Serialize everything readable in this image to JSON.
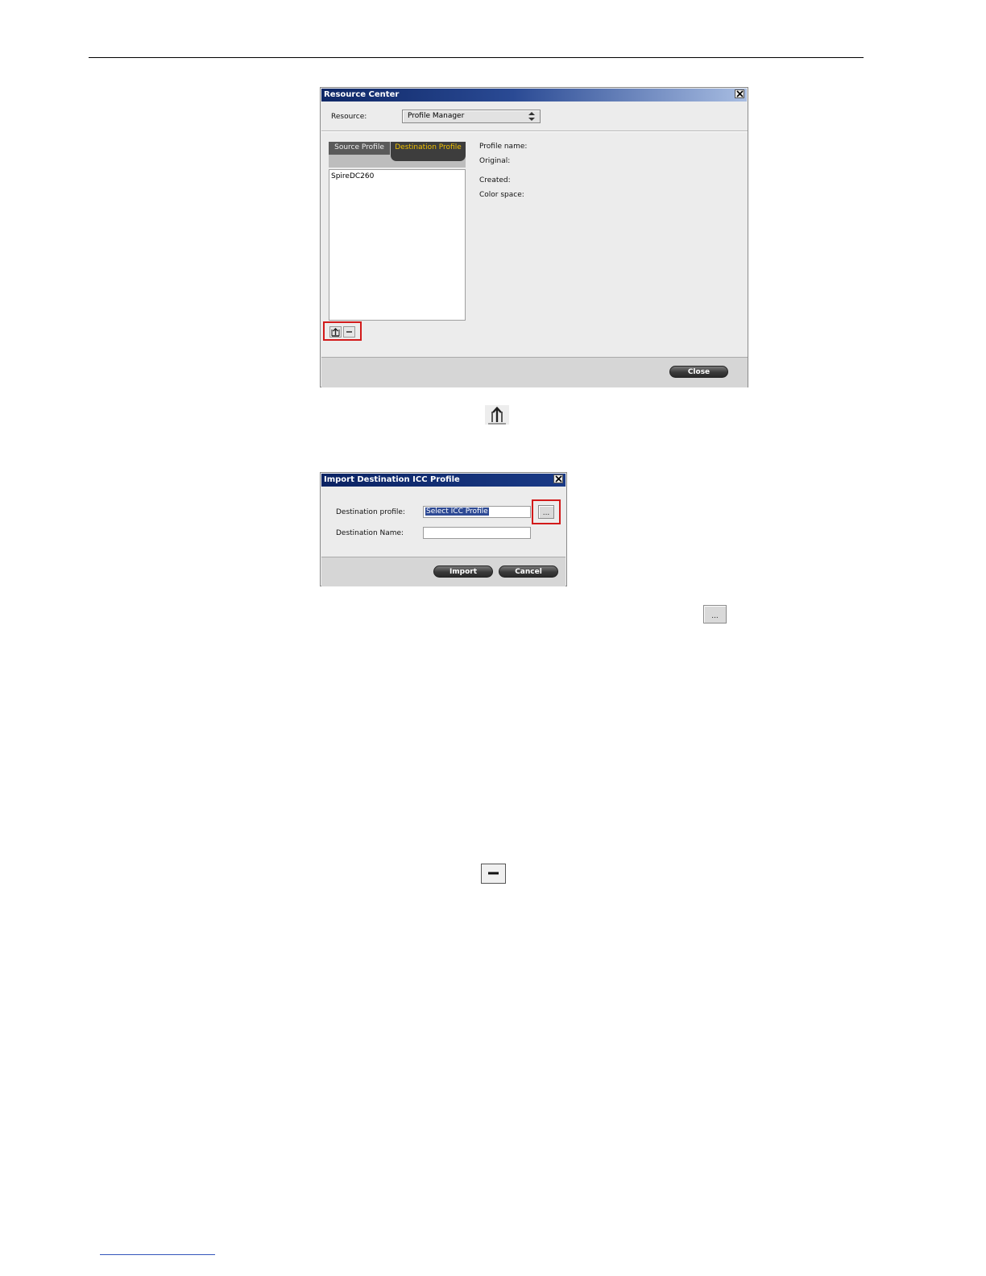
{
  "resource_center": {
    "title": "Resource Center",
    "resource_label": "Resource:",
    "resource_value": "Profile Manager",
    "tabs": [
      {
        "label": "Source Profile",
        "active": false
      },
      {
        "label": "Destination Profile",
        "active": true
      }
    ],
    "profiles": [
      "SpireDC260"
    ],
    "details": {
      "profile_name": "Profile name:",
      "original": "Original:",
      "created": "Created:",
      "color_space": "Color space:"
    },
    "close_label": "Close"
  },
  "import_dialog": {
    "title": "Import Destination ICC Profile",
    "destination_profile_label": "Destination profile:",
    "destination_profile_value": "Select ICC Profile",
    "destination_name_label": "Destination Name:",
    "destination_name_value": "",
    "browse_label": "...",
    "import_label": "Import",
    "cancel_label": "Cancel"
  },
  "inline_icons": {
    "browse_label": "..."
  },
  "colors": {
    "highlight_red": "#d21a1a",
    "tab_active_text": "#f0c000",
    "title_bar": "#0e2766"
  }
}
